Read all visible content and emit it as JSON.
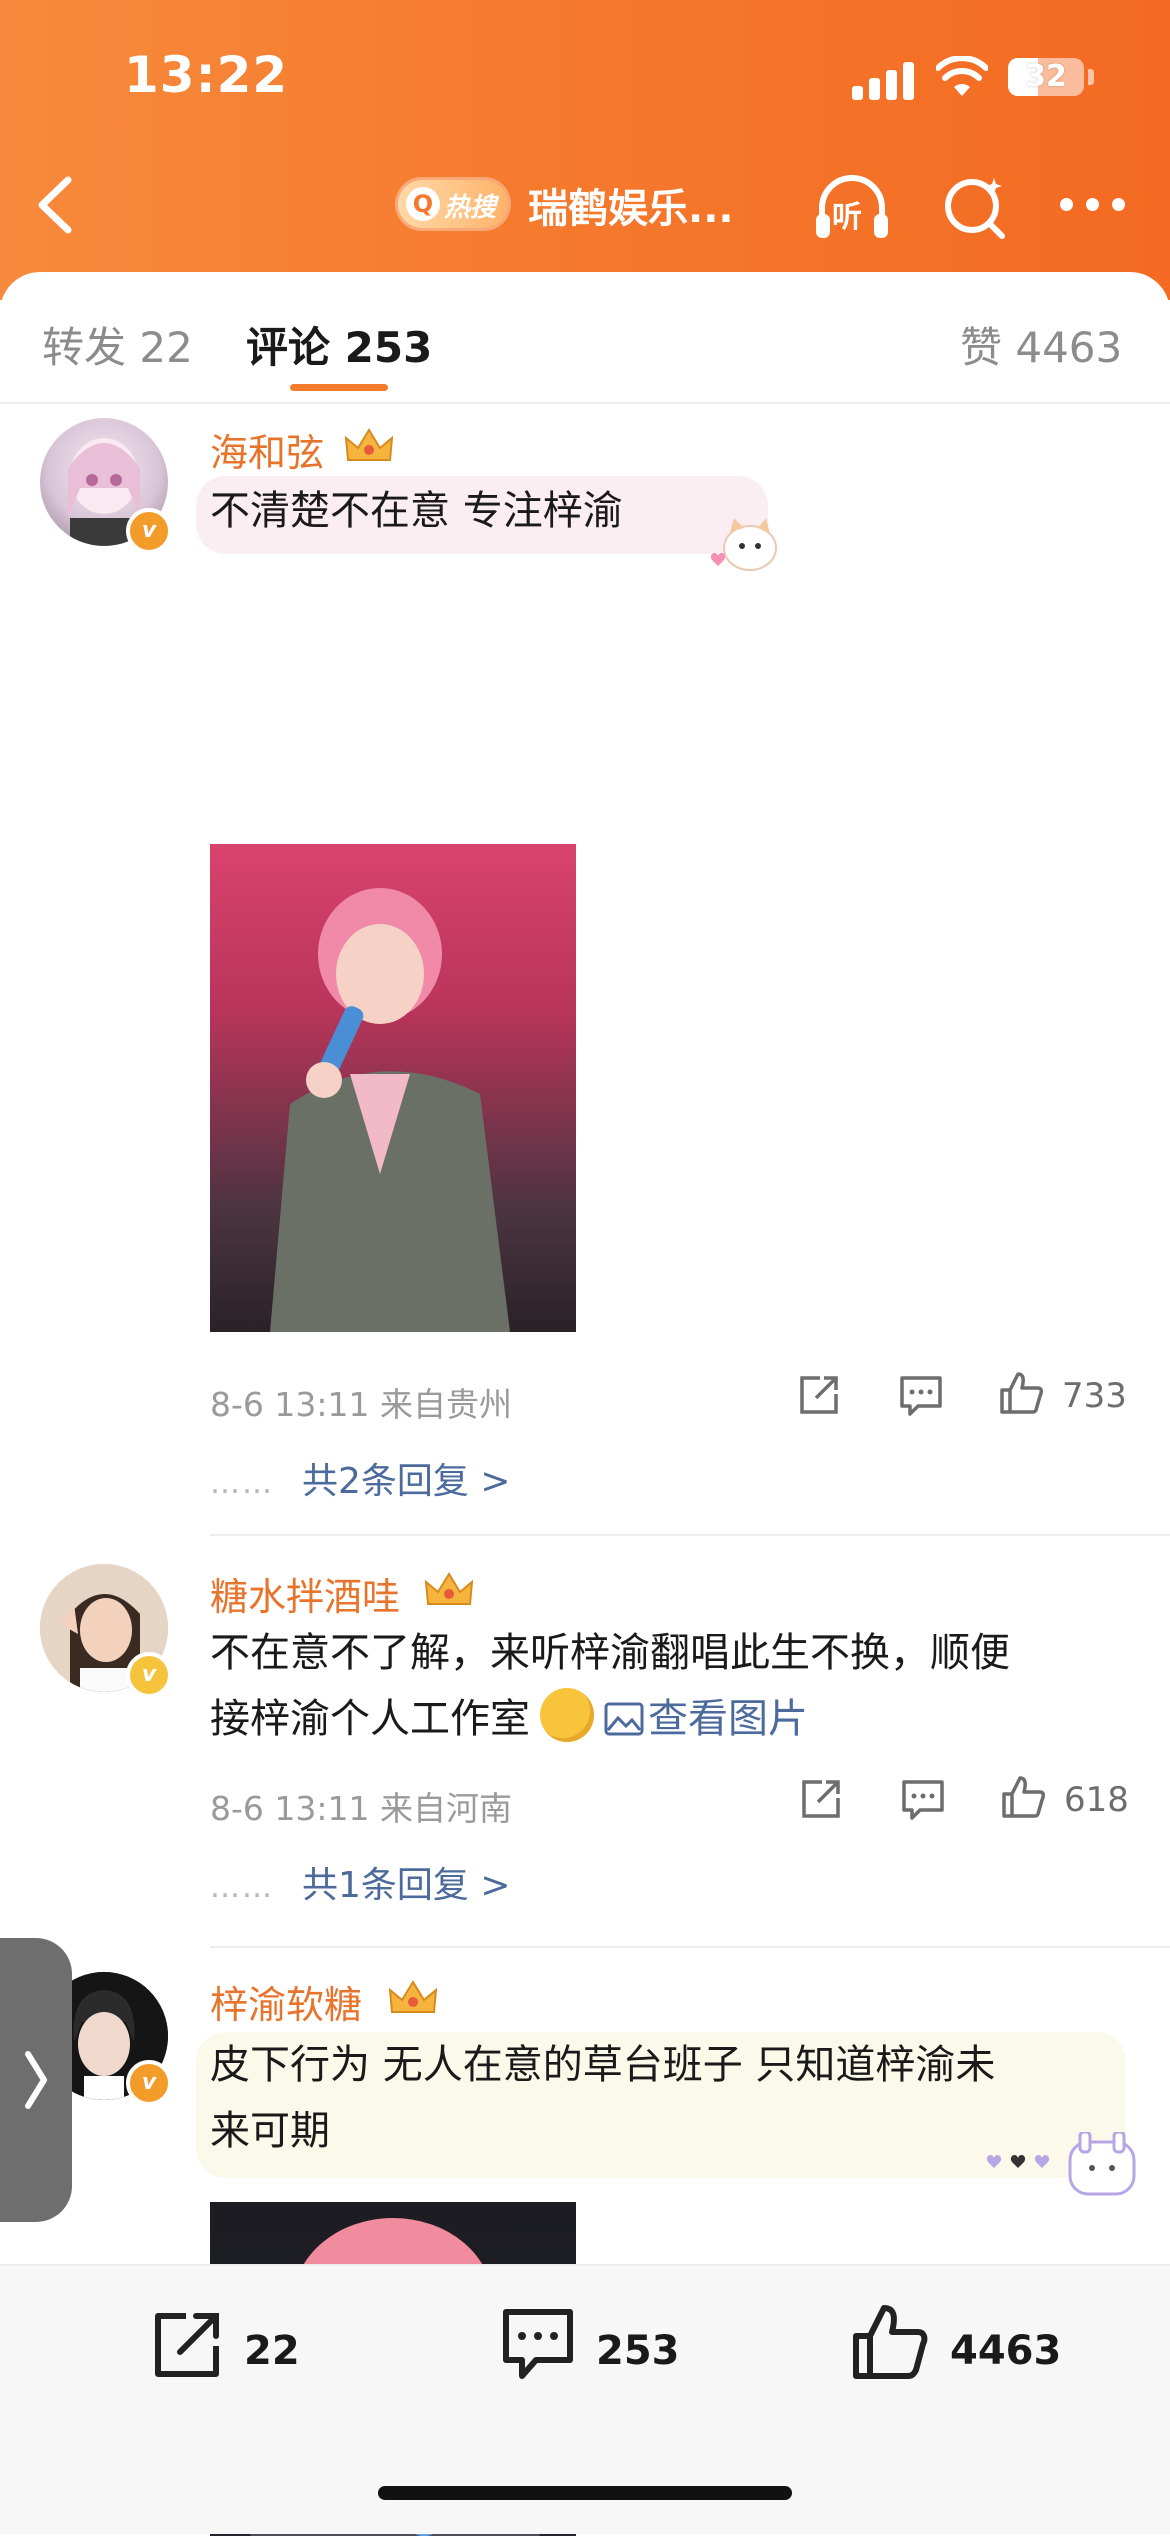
{
  "status_bar": {
    "time": "13:22",
    "battery": "32"
  },
  "header": {
    "hot_label": "热搜",
    "title": "瑞鹤娱乐...",
    "listen_label": "听"
  },
  "tabs": {
    "repost": "转发 22",
    "comments": "评论 253",
    "likes": "赞 4463"
  },
  "colors": {
    "accent": "#f47c2c",
    "username": "#e8742b",
    "link": "#4c6a9b"
  },
  "comments": [
    {
      "username": "海和弦",
      "badge": "crown-icon",
      "text": "不清楚不在意 专注梓渝",
      "has_image": true,
      "meta": "8-6 13:11 来自贵州",
      "likes": "733",
      "replies": "共2条回复 >"
    },
    {
      "username": "糖水拌酒哇",
      "badge": "crown-icon",
      "text_line1": "不在意不了解，来听梓渝翻唱此生不换，顺便",
      "text_line2": "接梓渝个人工作室",
      "view_pic": "查看图片",
      "meta": "8-6 13:11 来自河南",
      "likes": "618",
      "replies": "共1条回复 >"
    },
    {
      "username": "梓渝软糖",
      "badge": "crown-icon",
      "text_line1": "皮下行为 无人在意的草台班子 只知道梓渝未",
      "text_line2": "来可期",
      "has_image": true
    }
  ],
  "bottom_bar": {
    "repost_count": "22",
    "comment_count": "253",
    "like_count": "4463"
  }
}
